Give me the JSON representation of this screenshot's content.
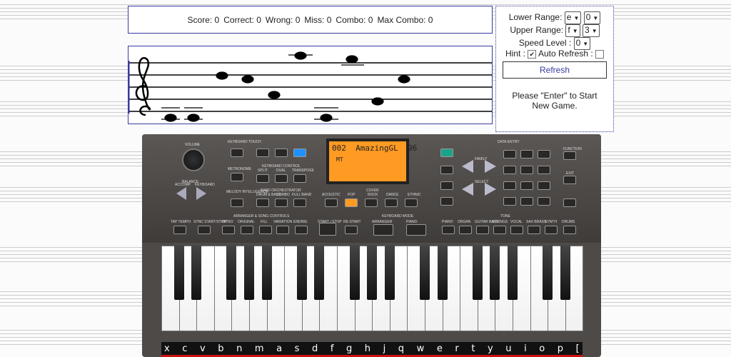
{
  "score_bar": {
    "score": "Score: 0",
    "correct": "Correct: 0",
    "wrong": "Wrong: 0",
    "miss": "Miss: 0",
    "combo": "Combo: 0",
    "max_combo": "Max Combo: 0"
  },
  "settings": {
    "lower_label": "Lower Range:",
    "lower_note": "e",
    "lower_octave": "0",
    "upper_label": "Upper Range:",
    "upper_note": "f",
    "upper_octave": "3",
    "speed_label": "Speed Level :",
    "speed_value": "0",
    "hint_label": "Hint :",
    "auto_refresh_label": "Auto Refresh :",
    "refresh_button": "Refresh",
    "message": "Please \"Enter\" to Start New Game."
  },
  "keyboard": {
    "lcd_line1": "002  AmazingGL  96",
    "lcd_line2": "MT",
    "key_letters": [
      "x",
      "c",
      "v",
      "b",
      "n",
      "m",
      "a",
      "s",
      "d",
      "f",
      "g",
      "h",
      "j",
      "q",
      "w",
      "e",
      "r",
      "t",
      "y",
      "u",
      "i",
      "o",
      "p",
      "["
    ],
    "panel_labels": [
      "VOLUME",
      "BALANCE",
      "ACCOMP",
      "KEYBOARD",
      "KEYBOARD TOUCH",
      "METRONOME",
      "MELODY INTELLIGENCE",
      "KEYBOARD CONTROL",
      "SPLIT",
      "DUAL",
      "TRANSPOSE",
      "BAND ORCHESTRATOR",
      "DRUM & BASS",
      "COMBO",
      "FULL BAND",
      "COVER",
      "ACOUSTIC",
      "POP",
      "ROCK",
      "DANCE",
      "ETHNIC",
      "DATA ENTRY",
      "FAMILY",
      "SELECT",
      "FUNCTION",
      "EXIT",
      "ARRANGER & SONG CONTROLS",
      "KEYBOARD MODE",
      "TONE",
      "TAP TEMPO",
      "SYNC START/STOP",
      "INTRO",
      "ORIGINAL",
      "FILL",
      "VARIATION",
      "ENDING",
      "START / STOP",
      "RE-START",
      "ARRANGER",
      "PIANO",
      "PIANO",
      "ORGAN",
      "GUITAR BASS",
      "STRINGS",
      "VOCAL",
      "SAX BRASS",
      "SYNTH",
      "DRUMS"
    ]
  }
}
